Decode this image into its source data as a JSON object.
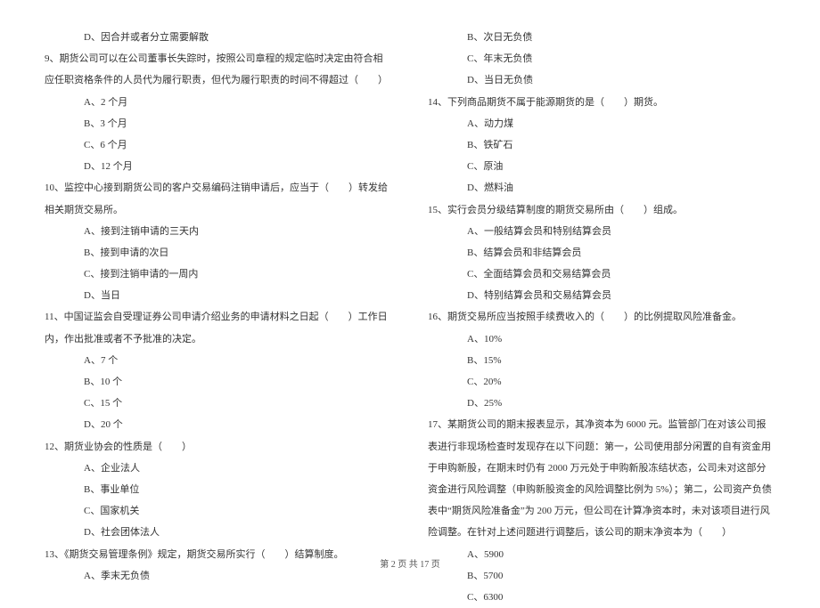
{
  "left": {
    "q8_d": "D、因合并或者分立需要解散",
    "q9": "9、期货公司可以在公司董事长失踪时，按照公司章程的规定临时决定由符合相应任职资格条件的人员代为履行职责，但代为履行职责的时间不得超过（　　）",
    "q9_a": "A、2 个月",
    "q9_b": "B、3 个月",
    "q9_c": "C、6 个月",
    "q9_d": "D、12 个月",
    "q10": "10、监控中心接到期货公司的客户交易编码注销申请后，应当于（　　）转发给相关期货交易所。",
    "q10_a": "A、接到注销申请的三天内",
    "q10_b": "B、接到申请的次日",
    "q10_c": "C、接到注销申请的一周内",
    "q10_d": "D、当日",
    "q11": "11、中国证监会自受理证券公司申请介绍业务的申请材料之日起（　　）工作日内，作出批准或者不予批准的决定。",
    "q11_a": "A、7 个",
    "q11_b": "B、10 个",
    "q11_c": "C、15 个",
    "q11_d": "D、20 个",
    "q12": "12、期货业协会的性质是（　　）",
    "q12_a": "A、企业法人",
    "q12_b": "B、事业单位",
    "q12_c": "C、国家机关",
    "q12_d": "D、社会团体法人",
    "q13": "13、《期货交易管理条例》规定，期货交易所实行（　　）结算制度。",
    "q13_a": "A、季末无负债"
  },
  "right": {
    "q13_b": "B、次日无负债",
    "q13_c": "C、年末无负债",
    "q13_d": "D、当日无负债",
    "q14": "14、下列商品期货不属于能源期货的是（　　）期货。",
    "q14_a": "A、动力煤",
    "q14_b": "B、铁矿石",
    "q14_c": "C、原油",
    "q14_d": "D、燃料油",
    "q15": "15、实行会员分级结算制度的期货交易所由（　　）组成。",
    "q15_a": "A、一般结算会员和特别结算会员",
    "q15_b": "B、结算会员和非结算会员",
    "q15_c": "C、全面结算会员和交易结算会员",
    "q15_d": "D、特别结算会员和交易结算会员",
    "q16": "16、期货交易所应当按照手续费收入的（　　）的比例提取风险准备金。",
    "q16_a": "A、10%",
    "q16_b": "B、15%",
    "q16_c": "C、20%",
    "q16_d": "D、25%",
    "q17": "17、某期货公司的期末报表显示，其净资本为 6000 元。监管部门在对该公司报表进行非现场检查时发现存在以下问题：第一，公司使用部分闲置的自有资金用于申购新股，在期末时仍有 2000 万元处于申购新股冻结状态，公司未对这部分资金进行风险调整（申购新股资金的风险调整比例为 5%）；第二，公司资产负债表中“期货风险准备金”为 200 万元，但公司在计算净资本时，未对该项目进行风险调整。在针对上述问题进行调整后，该公司的期末净资本为（　　）",
    "q17_a": "A、5900",
    "q17_b": "B、5700",
    "q17_c": "C、6300"
  },
  "footer": "第 2 页 共 17 页"
}
